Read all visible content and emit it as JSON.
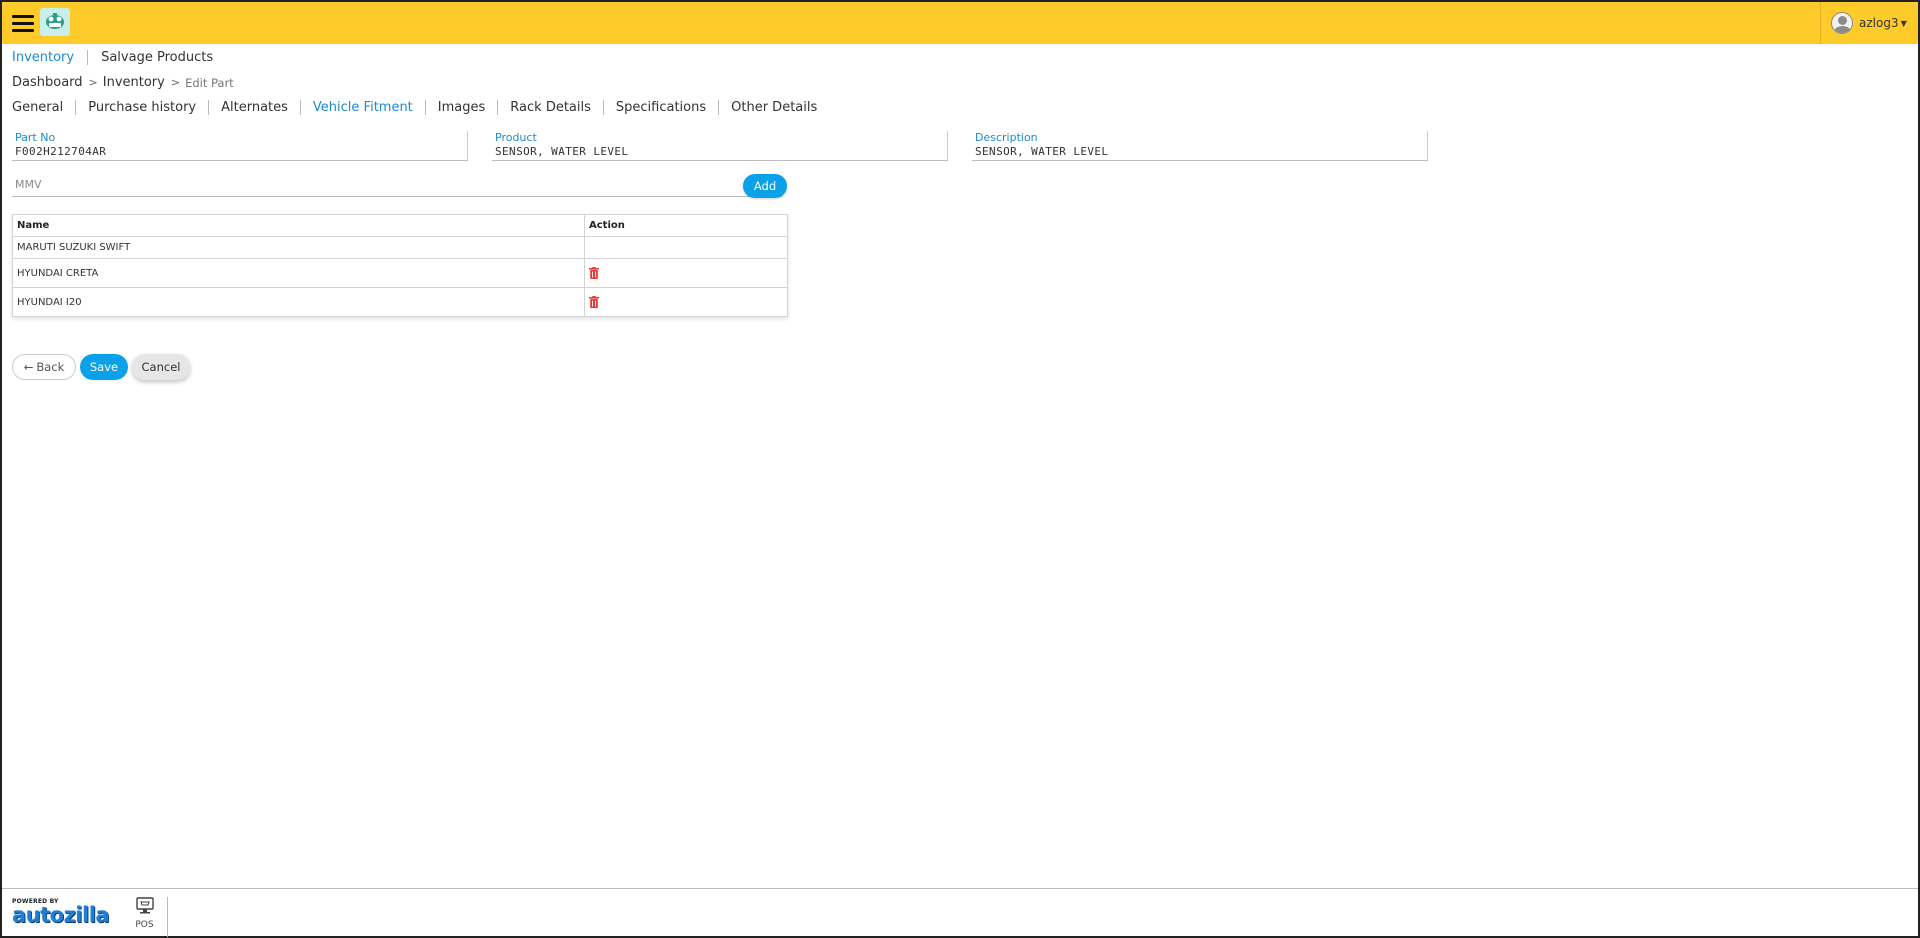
{
  "header": {
    "user": {
      "name": "azlog3"
    }
  },
  "subnav": {
    "items": [
      {
        "label": "Inventory",
        "active": true
      },
      {
        "label": "Salvage Products",
        "active": false
      }
    ]
  },
  "breadcrumb": {
    "items": [
      "Dashboard",
      "Inventory"
    ],
    "current": "Edit Part",
    "separator": ">"
  },
  "tabs": [
    {
      "label": "General",
      "active": false
    },
    {
      "label": "Purchase history",
      "active": false
    },
    {
      "label": "Alternates",
      "active": false
    },
    {
      "label": "Vehicle Fitment",
      "active": true
    },
    {
      "label": "Images",
      "active": false
    },
    {
      "label": "Rack Details",
      "active": false
    },
    {
      "label": "Specifications",
      "active": false
    },
    {
      "label": "Other Details",
      "active": false
    }
  ],
  "fields": {
    "part_no": {
      "label": "Part No",
      "value": "F002H212704AR"
    },
    "product": {
      "label": "Product",
      "value": "SENSOR, WATER LEVEL"
    },
    "description": {
      "label": "Description",
      "value": "SENSOR, WATER LEVEL"
    }
  },
  "mmv": {
    "placeholder": "MMV",
    "add_label": "Add"
  },
  "fitment_table": {
    "headers": [
      "Name",
      "Action"
    ],
    "rows": [
      {
        "name": "MARUTI SUZUKI SWIFT",
        "deletable": false
      },
      {
        "name": "HYUNDAI CRETA",
        "deletable": true
      },
      {
        "name": "HYUNDAI I20",
        "deletable": true
      }
    ]
  },
  "actions": {
    "back_label": "Back",
    "save_label": "Save",
    "cancel_label": "Cancel"
  },
  "footer": {
    "powered_by": "POWERED BY",
    "brand": "autozilla",
    "pos_label": "POS"
  },
  "colors": {
    "topbar": "#fecb2b",
    "accent": "#1a8bd0",
    "button": "#0ba1e8",
    "delete": "#e53935"
  },
  "icons": {
    "menu": "hamburger-icon",
    "logo": "company-logo",
    "user": "user-avatar-icon",
    "delete": "trash-icon",
    "back": "arrow-left-icon",
    "pos": "pos-register-icon"
  }
}
